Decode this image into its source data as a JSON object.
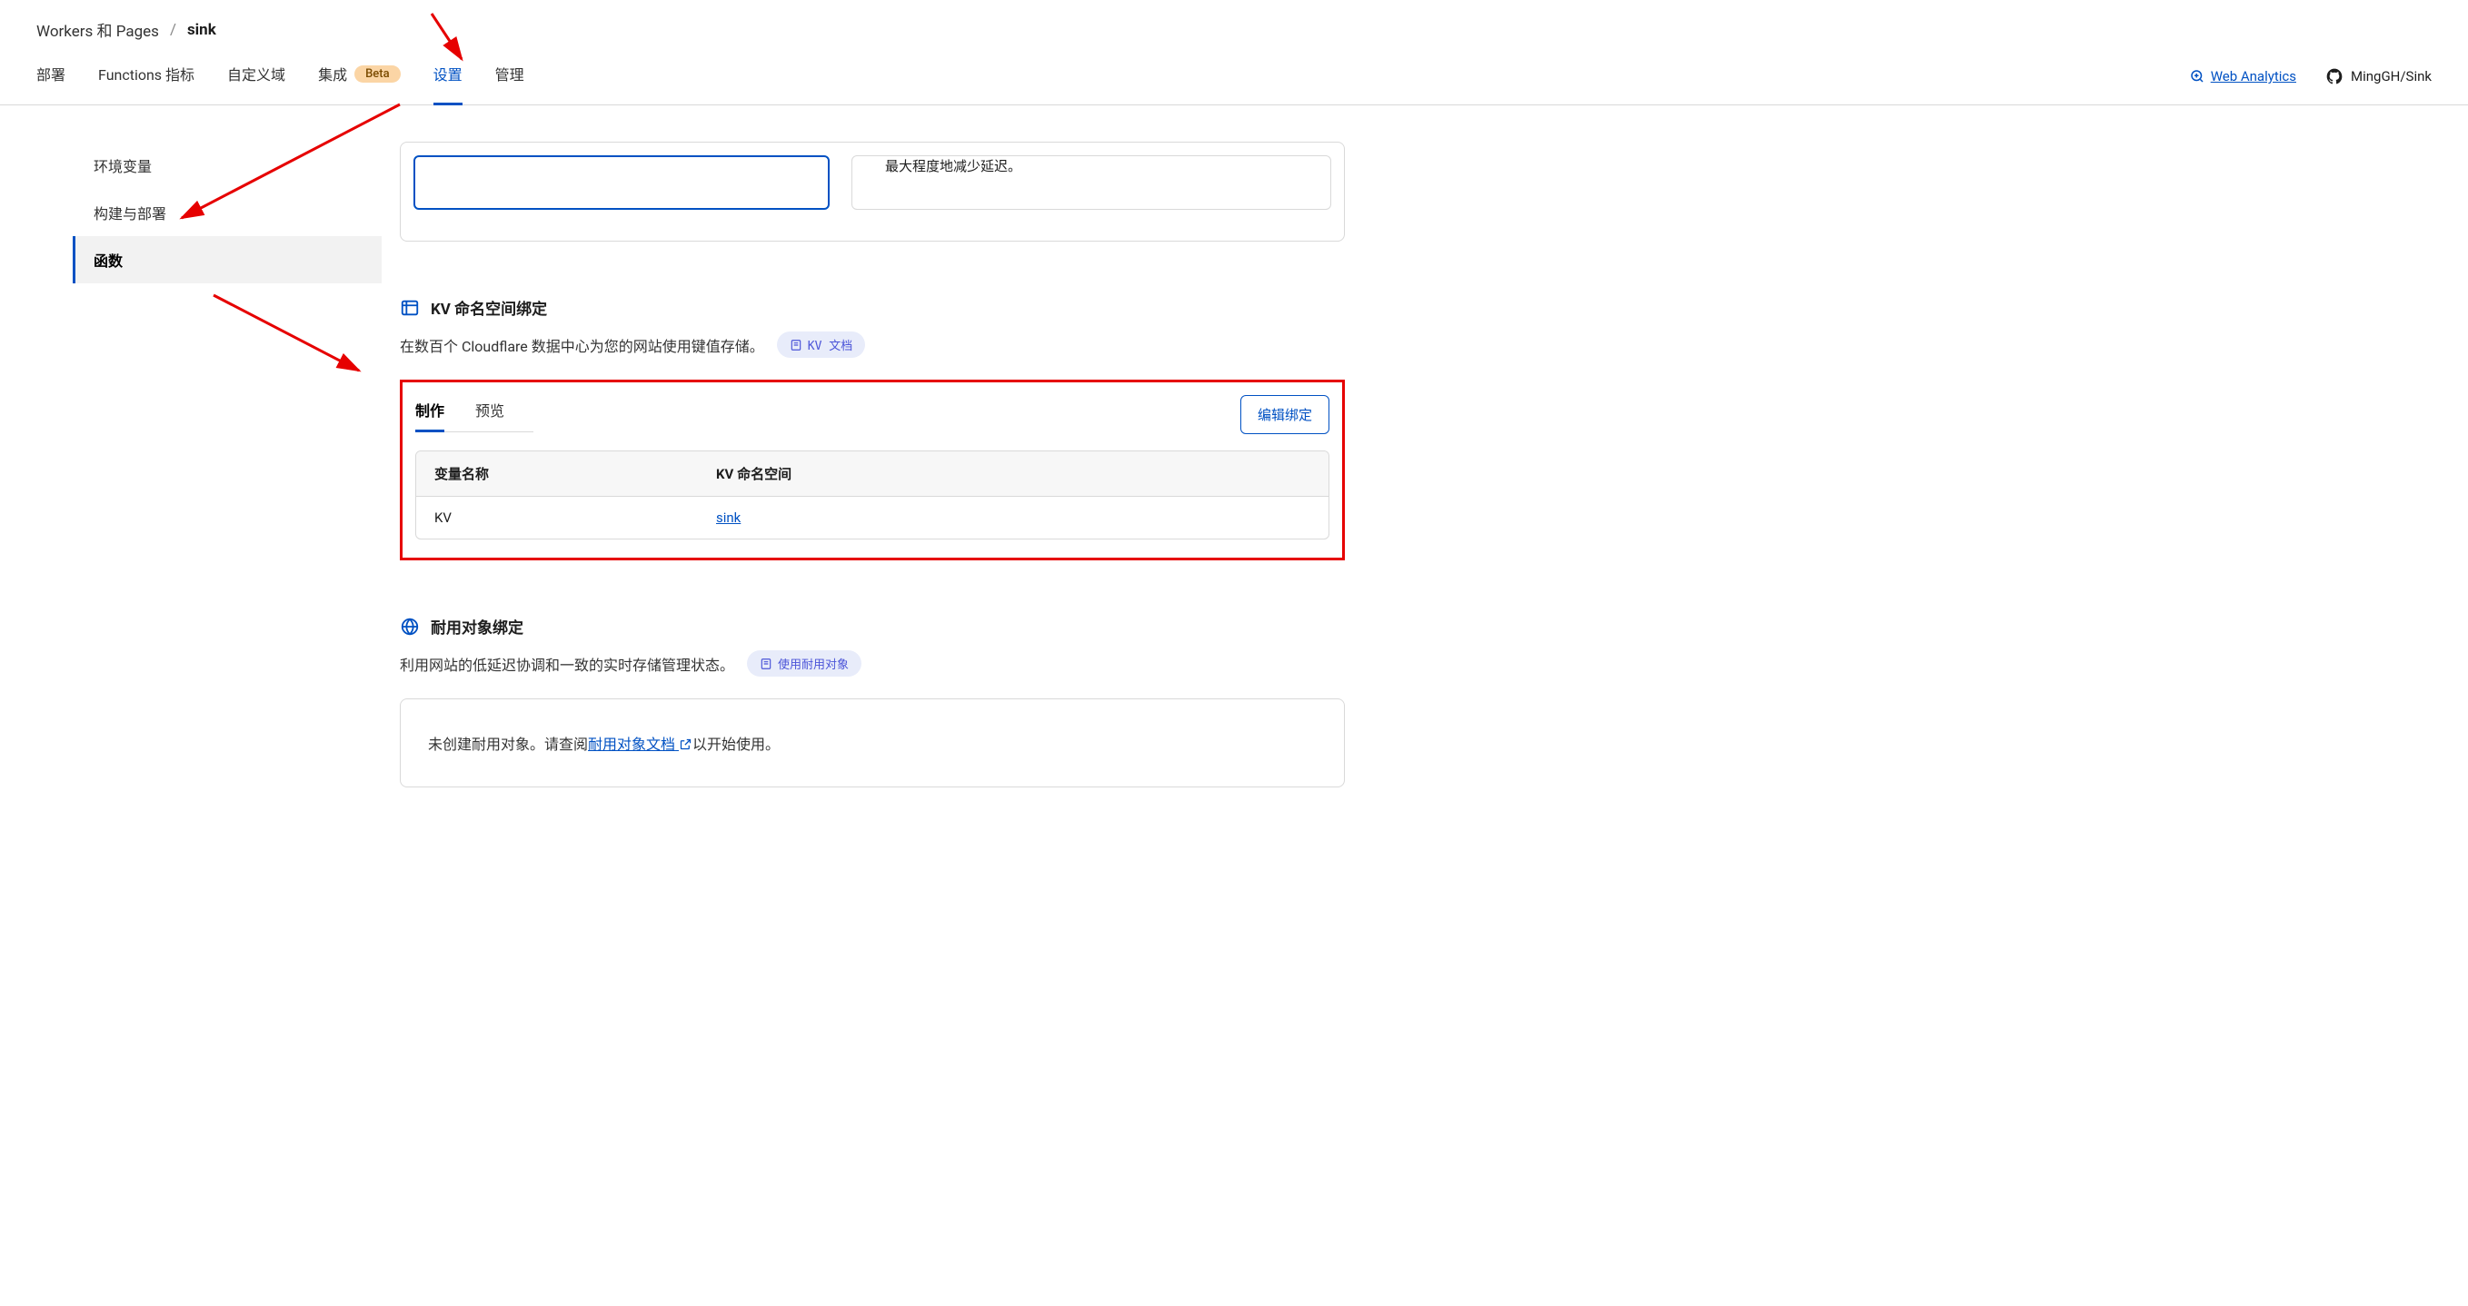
{
  "breadcrumb": {
    "root": "Workers 和 Pages",
    "sep": "/",
    "current": "sink"
  },
  "tabs": {
    "deploy": "部署",
    "functions_metrics": "Functions 指标",
    "custom_domain": "自定义域",
    "integration": "集成",
    "integration_badge": "Beta",
    "settings": "设置",
    "manage": "管理"
  },
  "header_right": {
    "web_analytics": "Web Analytics",
    "repo": "MingGH/Sink"
  },
  "sidebar": {
    "env": "环境变量",
    "build": "构建与部署",
    "functions": "函数"
  },
  "prev_card_text": "最大程度地减少延迟。",
  "kv": {
    "title": "KV 命名空间绑定",
    "desc": "在数百个 Cloudflare 数据中心为您的网站使用键值存储。",
    "doc_badge": "KV 文档",
    "edit_btn": "编辑绑定",
    "sub_tabs": {
      "prod": "制作",
      "preview": "预览"
    },
    "table": {
      "col1": "变量名称",
      "col2": "KV 命名空间",
      "row": {
        "name": "KV",
        "ns": "sink"
      }
    }
  },
  "durable": {
    "title": "耐用对象绑定",
    "desc": "利用网站的低延迟协调和一致的实时存储管理状态。",
    "doc_badge": "使用耐用对象",
    "placeholder_prefix": "未创建耐用对象。请查阅",
    "placeholder_link": "耐用对象文档",
    "placeholder_suffix": "以开始使用。"
  }
}
